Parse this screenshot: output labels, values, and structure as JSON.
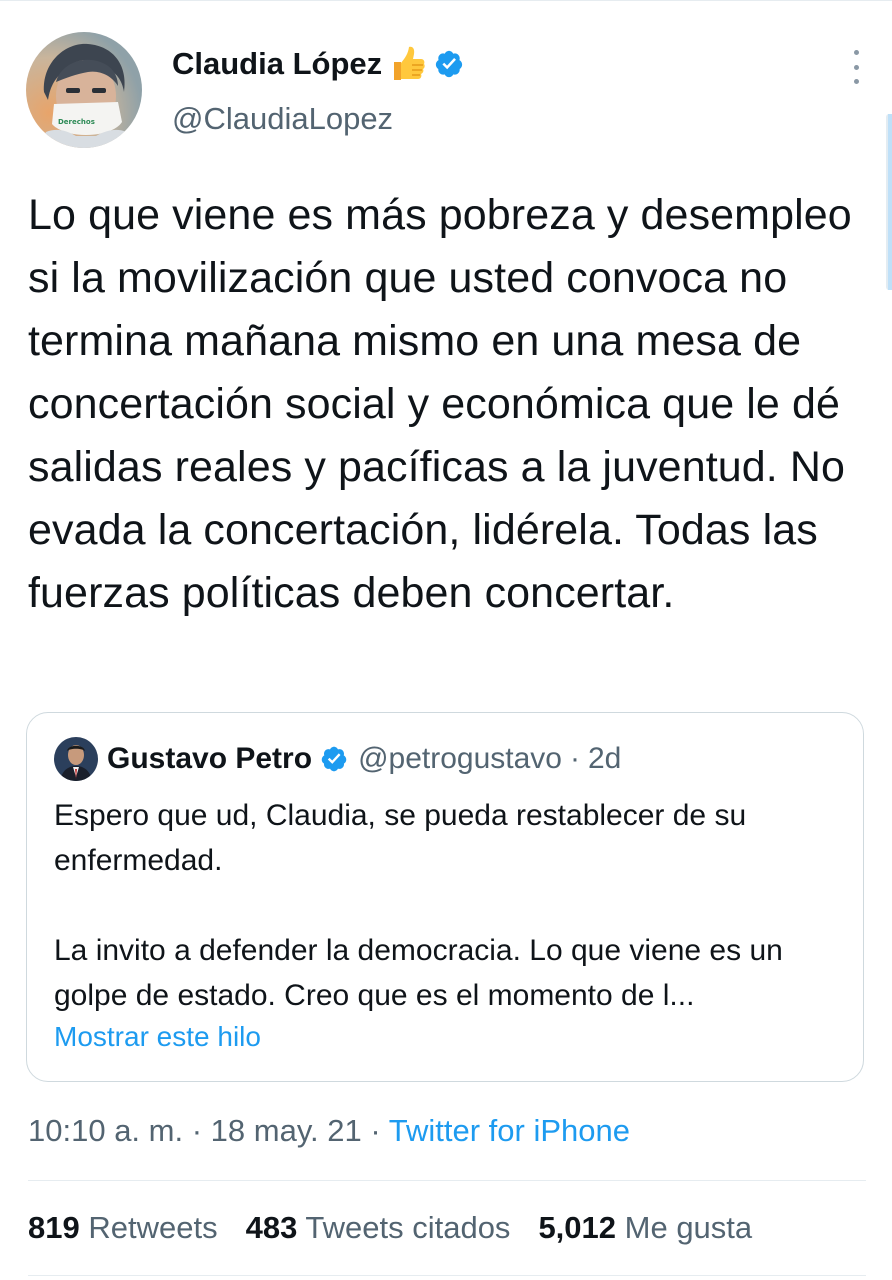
{
  "author": {
    "display_name": "Claudia López",
    "handle": "@ClaudiaLopez"
  },
  "tweet": {
    "text": "Lo que viene es más pobreza y desempleo si la movilización que usted convoca no termina mañana mismo en una mesa de concertación social y económica que le dé salidas reales y pacíficas a la juventud. No evada la concertación, lidérela. Todas las fuerzas políticas deben concertar."
  },
  "quoted_tweet": {
    "display_name": "Gustavo Petro",
    "handle": "@petrogustavo",
    "separator": "·",
    "time": "2d",
    "paragraph_1": "Espero que ud, Claudia, se pueda restablecer de su enfermedad.",
    "paragraph_2": "La invito a defender la democracia. Lo que viene es un golpe de estado. Creo que es el momento de l...",
    "show_thread": "Mostrar este hilo"
  },
  "meta": {
    "time": "10:10 a. m.",
    "sep1": "·",
    "date": "18 may. 21",
    "sep2": "·",
    "source": "Twitter for iPhone"
  },
  "stats": {
    "retweets_count": "819",
    "retweets_label": "Retweets",
    "quotes_count": "483",
    "quotes_label": "Tweets citados",
    "likes_count": "5,012",
    "likes_label": "Me gusta"
  },
  "colors": {
    "link_blue": "#1d9bf0",
    "verified_blue": "#1d9bf0",
    "secondary_text": "#536471"
  },
  "icons": {
    "verified": "verified-badge-icon",
    "thumbs_up": "thumbs-up-emoji-icon",
    "more": "more-vertical-icon"
  }
}
